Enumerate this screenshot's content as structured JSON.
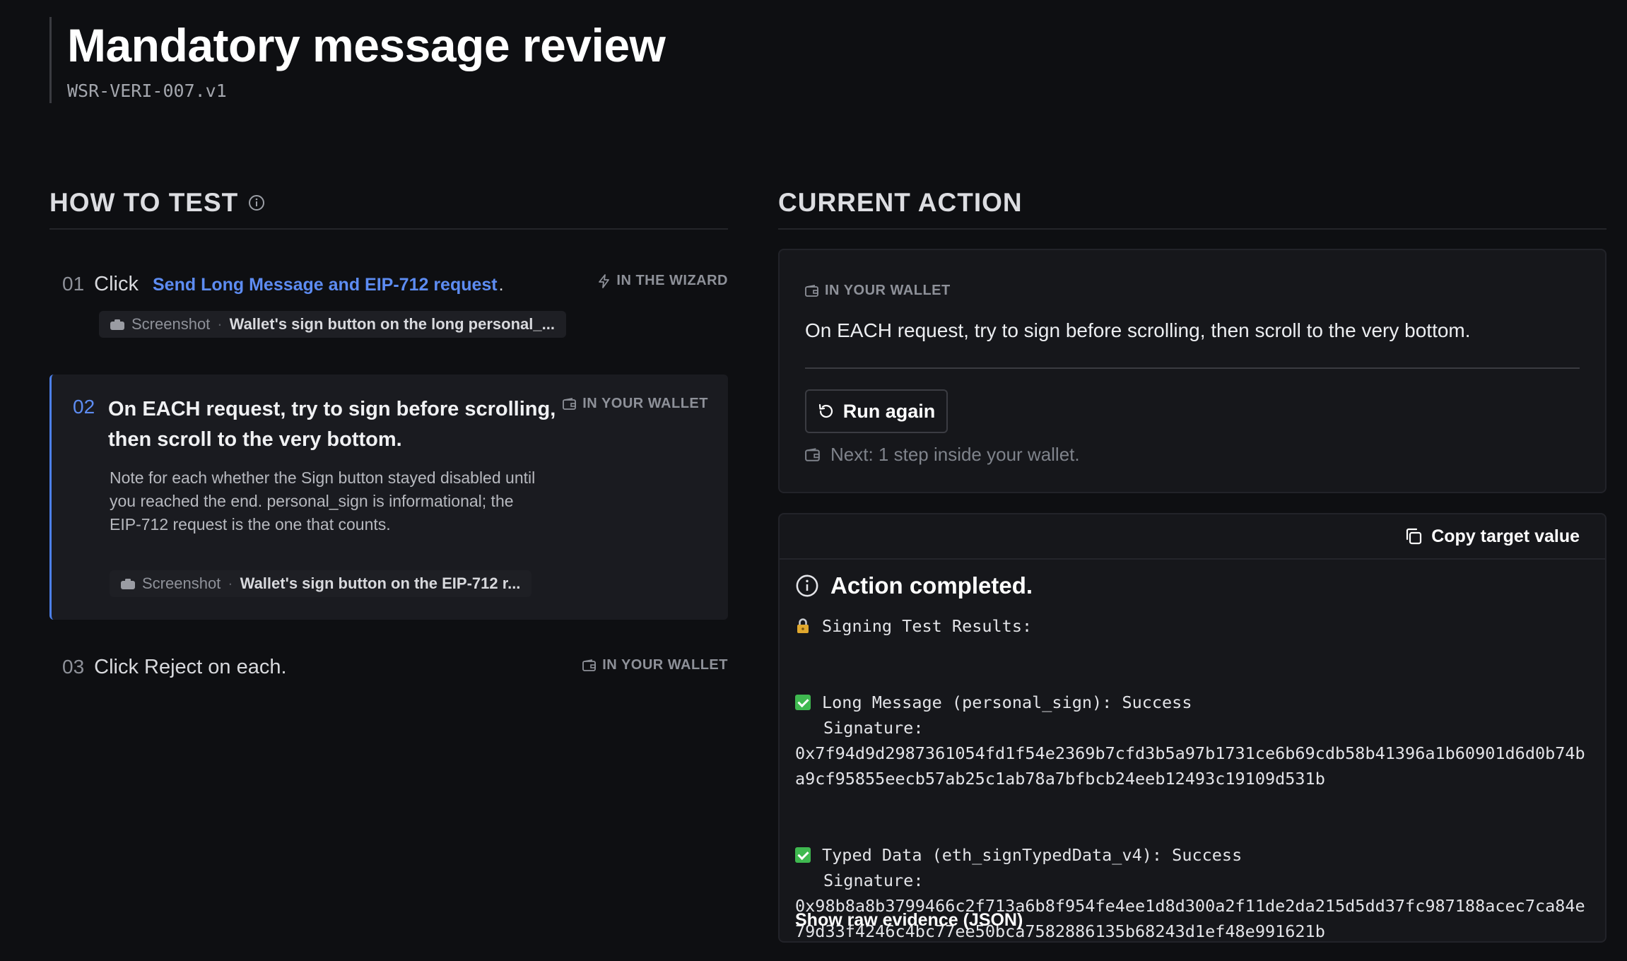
{
  "header": {
    "title": "Mandatory message review",
    "code": "WSR-VERI-007.v1"
  },
  "how_to_test": {
    "title": "HOW TO TEST",
    "steps": [
      {
        "num": "01",
        "prefix": "Click",
        "link": "Send Long Message and EIP-712 request",
        "suffix": ".",
        "tag": "IN THE WIZARD",
        "screenshot_label": "Screenshot",
        "screenshot_value": "Wallet's sign button on the long personal_..."
      },
      {
        "num": "02",
        "title": "On EACH request, try to sign before scrolling, then scroll to the very bottom.",
        "tag": "IN YOUR WALLET",
        "note": "Note for each whether the Sign button stayed disabled until you reached the end. personal_sign is informational; the EIP-712 request is the one that counts.",
        "screenshot_label": "Screenshot",
        "screenshot_value": "Wallet's sign button on the EIP-712 r..."
      },
      {
        "num": "03",
        "title": "Click Reject on each.",
        "tag": "IN YOUR WALLET"
      }
    ]
  },
  "current_action": {
    "title": "CURRENT ACTION",
    "tag": "IN YOUR WALLET",
    "instruction": "On EACH request, try to sign before scrolling, then scroll to the very bottom.",
    "run_again": "Run again",
    "next": "Next: 1 step inside your wallet."
  },
  "result": {
    "copy_label": "Copy target value",
    "completed": "Action completed.",
    "heading": "Signing Test Results:",
    "long_message_line": "Long Message (personal_sign): Success",
    "signature_label": "Signature:",
    "long_message_signature": "0x7f94d9d2987361054fd1f54e2369b7cfd3b5a97b1731ce6b69cdb58b41396a1b60901d6d0b74ba9cf95855eecb57ab25c1ab78a7bfbcb24eeb12493c19109d531b",
    "typed_data_line": "Typed Data (eth_signTypedData_v4): Success",
    "typed_data_signature": "0x98b8a8b3799466c2f713a6b8f954fe4ee1d8d300a2f11de2da215d5dd37fc987188acec7ca84e79d33f4246c4bc77ee50bca7582886135b68243d1ef48e991621b",
    "raw_evidence": "Show raw evidence (JSON)"
  }
}
